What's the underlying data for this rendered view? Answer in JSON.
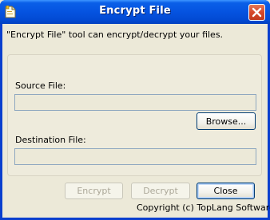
{
  "window": {
    "title": "Encrypt File"
  },
  "description": "\"Encrypt File\" tool can encrypt/decrypt your files.",
  "source": {
    "label": "Source File:",
    "value": "",
    "browse_label": "Browse..."
  },
  "destination": {
    "label": "Destination File:",
    "value": ""
  },
  "buttons": {
    "encrypt_label": "Encrypt",
    "decrypt_label": "Decrypt",
    "close_label": "Close"
  },
  "footer": {
    "copyright": "Copyright (c) TopLang Software."
  },
  "icons": {
    "app_icon": "document-lock-icon",
    "close_icon": "close-x-icon"
  },
  "colors": {
    "titlebar": "#0553e0",
    "close_button": "#d6482a",
    "dialog_background": "#ece9d8"
  }
}
